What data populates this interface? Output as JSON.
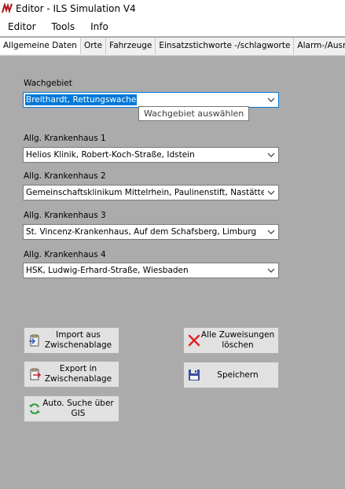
{
  "window": {
    "title": "Editor - ILS Simulation V4"
  },
  "menu": [
    "Editor",
    "Tools",
    "Info"
  ],
  "tabs": [
    "Allgemeine Daten",
    "Orte",
    "Fahrzeuge",
    "Einsatzstichworte -/schlagworte",
    "Alarm-/Ausrü"
  ],
  "fields": {
    "wachgebiet": {
      "label": "Wachgebiet",
      "value": "Breithardt, Rettungswache",
      "tooltip": "Wachgebiet auswählen"
    },
    "kh1": {
      "label": "Allg. Krankenhaus 1",
      "value": "Helios Klinik, Robert-Koch-Straße, Idstein"
    },
    "kh2": {
      "label": "Allg. Krankenhaus 2",
      "value": "Gemeinschaftsklinikum Mittelrhein, Paulinenstift, Nastätten"
    },
    "kh3": {
      "label": "Allg. Krankenhaus 3",
      "value": "St. Vincenz-Krankenhaus, Auf dem Schafsberg, Limburg"
    },
    "kh4": {
      "label": "Allg. Krankenhaus 4",
      "value": "HSK, Ludwig-Erhard-Straße, Wiesbaden"
    }
  },
  "buttons": {
    "import": "Import aus Zwischenablage",
    "export": "Export in Zwischenablage",
    "auto": "Auto. Suche über GIS",
    "delete": "Alle Zuweisungen löschen",
    "save": "Speichern"
  },
  "colors": {
    "background": "#ababab",
    "selection": "#0078d7",
    "delete_icon": "#e02020",
    "save_icon": "#3a4fa0",
    "refresh_icon": "#2e9a3a"
  }
}
